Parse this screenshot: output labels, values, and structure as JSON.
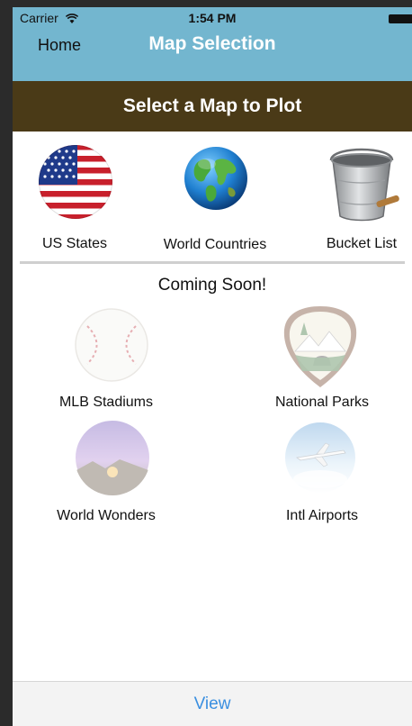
{
  "status_bar": {
    "carrier": "Carrier",
    "time": "1:54 PM"
  },
  "nav": {
    "back_label": "Home",
    "title": "Map Selection"
  },
  "header": {
    "title": "Select a Map to Plot"
  },
  "maps": [
    {
      "label": "US States",
      "icon": "us-flag-icon"
    },
    {
      "label": "World Countries",
      "icon": "globe-icon"
    },
    {
      "label": "Bucket List",
      "icon": "bucket-icon"
    }
  ],
  "coming_soon": {
    "heading": "Coming Soon!",
    "items": [
      {
        "label": "MLB Stadiums",
        "icon": "baseball-icon"
      },
      {
        "label": "National Parks",
        "icon": "national-park-service-icon"
      },
      {
        "label": "World Wonders",
        "icon": "world-wonders-icon"
      },
      {
        "label": "Intl Airports",
        "icon": "airplane-icon"
      }
    ]
  },
  "tab_bar": {
    "view_label": "View"
  },
  "colors": {
    "nav_bar": "#73b6cf",
    "header_band": "#4a3a17",
    "tab_text": "#3a8fe0"
  }
}
